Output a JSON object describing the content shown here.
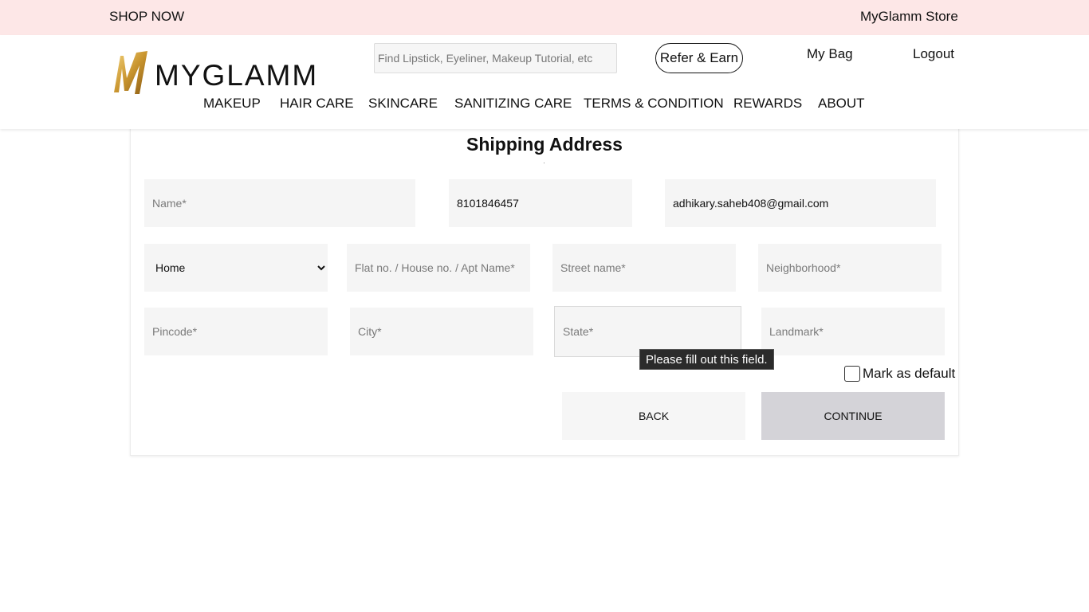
{
  "topbar": {
    "shop_now": "SHOP NOW",
    "store": "MyGlamm Store",
    "background": "#fde7e7"
  },
  "header": {
    "logo_text": "MYGLAMM",
    "logo_icon": "myglamm-gold-m-logo",
    "search_placeholder": "Find Lipstick, Eyeliner, Makeup Tutorial, etc",
    "refer_label": "Refer & Earn",
    "bag_label": "My Bag",
    "logout_label": "Logout"
  },
  "nav": [
    "MAKEUP",
    "HAIR CARE",
    "SKINCARE",
    "SANITIZING CARE",
    "TERMS & CONDITION",
    "REWARDS",
    "ABOUT"
  ],
  "form": {
    "title": "Shipping Address",
    "name_placeholder": "Name*",
    "phone_value": "8101846457",
    "email_value": "adhikary.saheb408@gmail.com",
    "address_type_selected": "Home",
    "flat_placeholder": "Flat no. / House no. / Apt Name*",
    "street_placeholder": "Street name*",
    "neighborhood_placeholder": "Neighborhood*",
    "pincode_placeholder": "Pincode*",
    "city_placeholder": "City*",
    "state_placeholder": "State*",
    "landmark_placeholder": "Landmark*",
    "validation_tooltip": "Please fill out this field.",
    "mark_default_label": "Mark as default",
    "back_label": "BACK",
    "continue_label": "CONTINUE"
  }
}
